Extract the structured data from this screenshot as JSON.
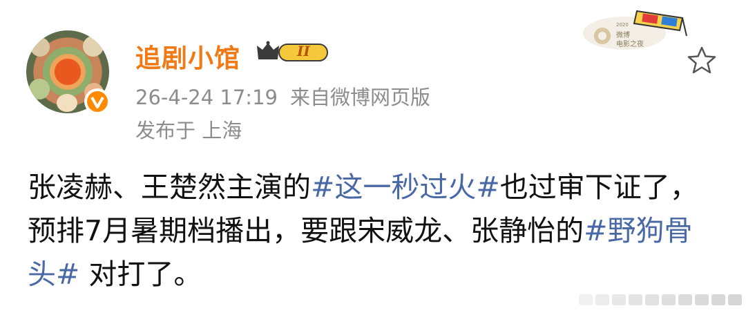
{
  "user": {
    "name": "追剧小馆",
    "vip_level": "II"
  },
  "meta": {
    "timestamp": "26-4-24 17:19",
    "source": "来自微博网页版",
    "location": "发布于 上海"
  },
  "badge": {
    "year": "2020",
    "line1": "微博",
    "line2": "电影之夜"
  },
  "post": {
    "text_1": "张凌赫、王楚然主演的",
    "tag_1": "#这一秒过火#",
    "text_2": "也过审下证了，预排7月暑期档播出，要跟宋威龙、张静怡的",
    "tag_2": "#野狗骨头#",
    "text_3": " 对打了。"
  },
  "colors": {
    "username": "#f07a16",
    "meta": "#8c8c8c",
    "topic_link": "#4868a6",
    "verified": "#ff8a00"
  },
  "icons": [
    "verified-badge-icon",
    "vip-crown-icon",
    "3d-glasses-icon",
    "star-icon"
  ]
}
